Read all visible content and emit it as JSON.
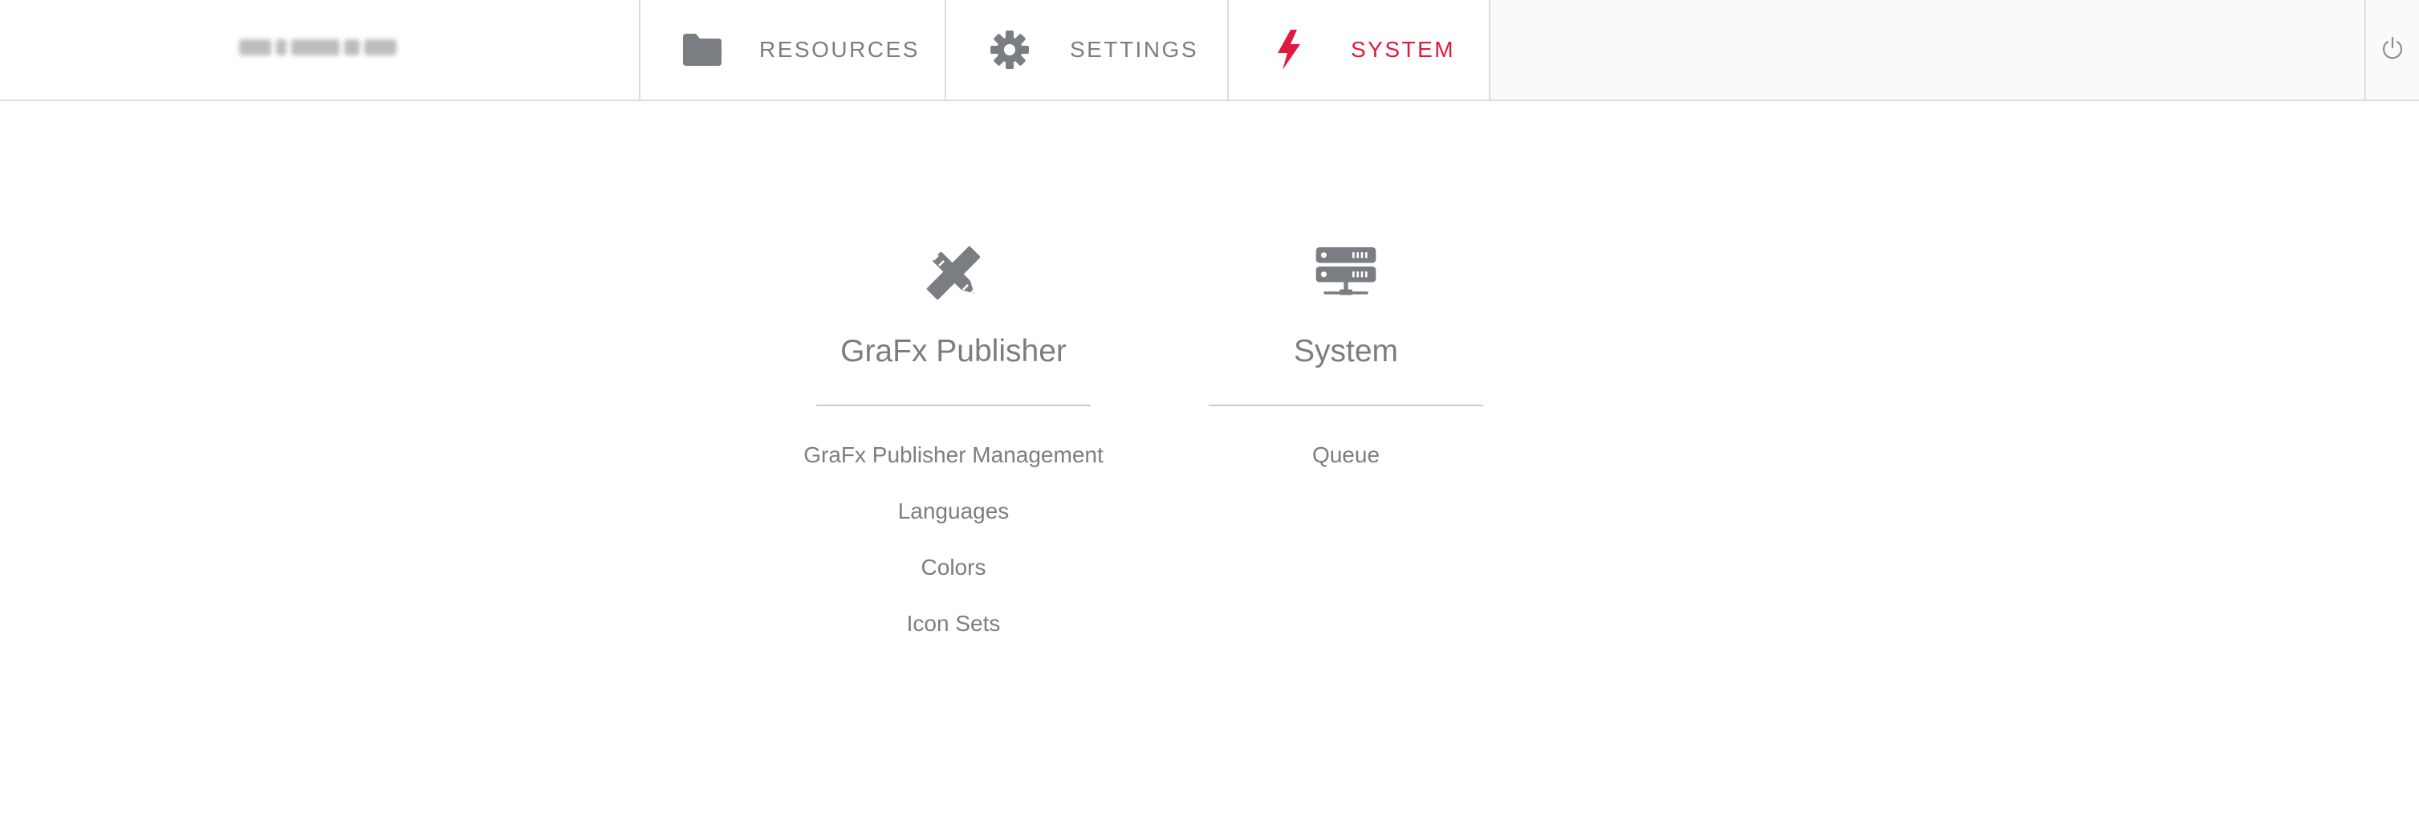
{
  "header": {
    "tabs": [
      {
        "label": "RESOURCES",
        "icon": "folder-icon"
      },
      {
        "label": "SETTINGS",
        "icon": "gear-icon"
      },
      {
        "label": "SYSTEM",
        "icon": "lightning-icon",
        "active": true
      }
    ],
    "power_icon": "power-icon"
  },
  "colors": {
    "accent": "#e2193c",
    "text": "#7a7e83",
    "border": "#dcdcdc",
    "bar_background": "#fafafa"
  },
  "sections": [
    {
      "title": "GraFx Publisher",
      "icon": "pencil-ruler-icon",
      "links": [
        "GraFx Publisher Management",
        "Languages",
        "Colors",
        "Icon Sets"
      ]
    },
    {
      "title": "System",
      "icon": "server-icon",
      "links": [
        "Queue"
      ]
    }
  ]
}
